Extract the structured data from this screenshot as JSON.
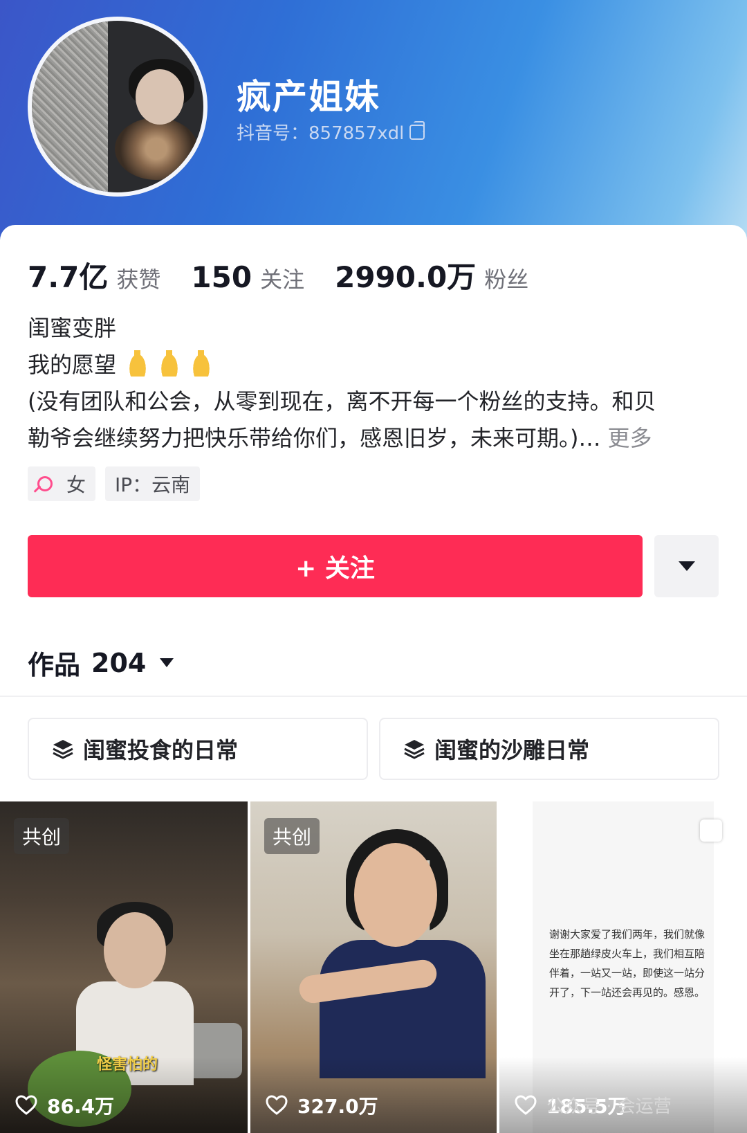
{
  "profile": {
    "nickname": "疯产姐妹",
    "douyin_id": "抖音号：857857xdl"
  },
  "stats": [
    {
      "value": "7.7亿",
      "label": "获赞"
    },
    {
      "value": "150",
      "label": "关注"
    },
    {
      "value": "2990.0万",
      "label": "粉丝"
    }
  ],
  "bio": {
    "line1": "闺蜜变胖",
    "line2": "我的愿望",
    "line3": "(没有团队和公会，从零到现在，离不开每一个粉丝的支持。和贝",
    "line4": "勒爷会继续努力把快乐带给你们，感恩旧岁，未来可期。)…",
    "more": "更多"
  },
  "tags": {
    "gender": "女",
    "ip": "IP：云南"
  },
  "actions": {
    "follow": "+ 关注"
  },
  "works": {
    "label": "作品",
    "count": "204"
  },
  "collections": [
    "闺蜜投食的日常",
    "闺蜜的沙雕日常"
  ],
  "videos": [
    {
      "badge": "共创",
      "likes": "86.4万",
      "subtitle": "怪害怕的"
    },
    {
      "badge": "共创",
      "likes": "327.0万"
    },
    {
      "likes": "185.5万",
      "note": "谢谢大家爱了我们两年，我们就像坐在那趟绿皮火车上，我们相互陪伴着，一站又一站，即使这一站分开了，下一站还会再见的。感恩。"
    }
  ],
  "watermark": "公众号 · 会运营",
  "colors": {
    "accent": "#fe2c55",
    "header_start": "#3b56c8",
    "header_end": "#b8ddf4"
  }
}
